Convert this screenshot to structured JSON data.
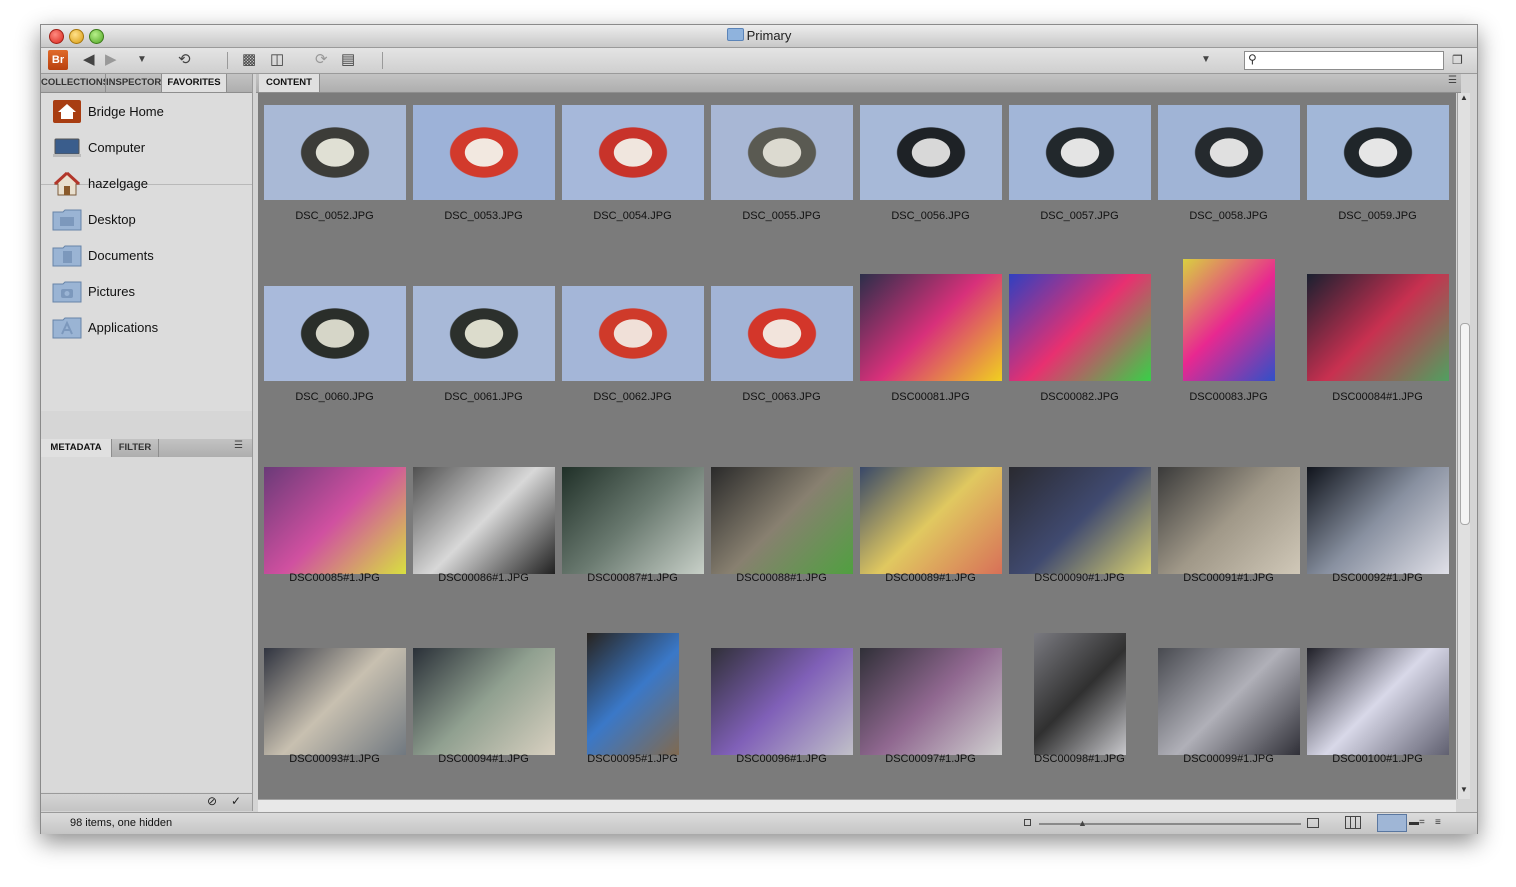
{
  "window": {
    "title": "Primary"
  },
  "toolbar": {
    "logo": "Br",
    "search_placeholder": ""
  },
  "left_tabs_top": [
    "COLLECTIONS",
    "INSPECTOR",
    "FAVORITES"
  ],
  "favorites": [
    {
      "label": "Bridge Home",
      "icon": "bridge-home-icon"
    },
    {
      "label": "Computer",
      "icon": "computer-icon"
    },
    {
      "label": "hazelgage",
      "icon": "home-folder-icon"
    },
    {
      "label": "Desktop",
      "icon": "desktop-folder-icon"
    },
    {
      "label": "Documents",
      "icon": "documents-folder-icon"
    },
    {
      "label": "Pictures",
      "icon": "pictures-folder-icon"
    },
    {
      "label": "Applications",
      "icon": "applications-folder-icon"
    }
  ],
  "left_tabs_bottom": [
    "METADATA",
    "FILTER"
  ],
  "content_tab": "CONTENT",
  "files": [
    "DSC_0052.JPG",
    "DSC_0053.JPG",
    "DSC_0054.JPG",
    "DSC_0055.JPG",
    "DSC_0056.JPG",
    "DSC_0057.JPG",
    "DSC_0058.JPG",
    "DSC_0059.JPG",
    "DSC_0060.JPG",
    "DSC_0061.JPG",
    "DSC_0062.JPG",
    "DSC_0063.JPG",
    "DSC00081.JPG",
    "DSC00082.JPG",
    "DSC00083.JPG",
    "DSC00084#1.JPG",
    "DSC00085#1.JPG",
    "DSC00086#1.JPG",
    "DSC00087#1.JPG",
    "DSC00088#1.JPG",
    "DSC00089#1.JPG",
    "DSC00090#1.JPG",
    "DSC00091#1.JPG",
    "DSC00092#1.JPG",
    "DSC00093#1.JPG",
    "DSC00094#1.JPG",
    "DSC00095#1.JPG",
    "DSC00096#1.JPG",
    "DSC00097#1.JPG",
    "DSC00098#1.JPG",
    "DSC00099#1.JPG",
    "DSC00100#1.JPG"
  ],
  "status": {
    "text": "98 items, one hidden"
  }
}
